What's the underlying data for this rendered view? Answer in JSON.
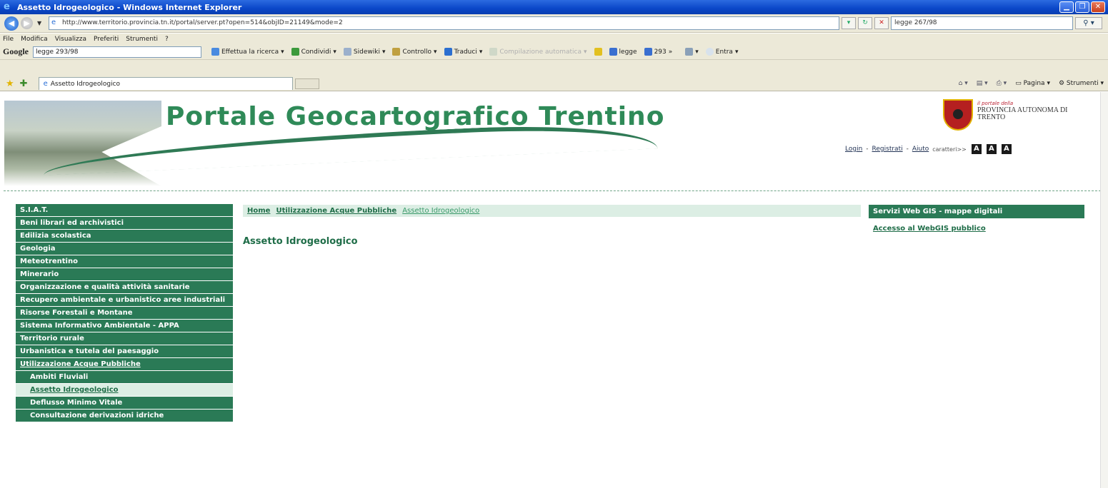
{
  "window": {
    "title": "Assetto Idrogeologico - Windows Internet Explorer"
  },
  "address": {
    "url": "http://www.territorio.provincia.tn.it/portal/server.pt?open=514&objID=21149&mode=2",
    "search": "legge 267/98"
  },
  "menu": [
    "File",
    "Modifica",
    "Visualizza",
    "Preferiti",
    "Strumenti",
    "?"
  ],
  "google_toolbar": {
    "logo": "Google",
    "query": "legge 293/98",
    "search_label": "Effettua la ricerca",
    "items": [
      "Condividi",
      "Sidewiki",
      "Controllo",
      "Traduci",
      "Compilazione automatica",
      "legge",
      "293",
      "Entra"
    ]
  },
  "tab": {
    "label": "Assetto Idrogeologico"
  },
  "commands": [
    "Pagina",
    "Strumenti"
  ],
  "banner": {
    "title": "Portale Geocartografico Trentino",
    "prov_small": "il portale della",
    "prov_name": "PROVINCIA AUTONOMA DI TRENTO",
    "links": {
      "login": "Login",
      "register": "Registrati",
      "help": "Aiuto",
      "chars": "caratteri>>",
      "sep": "-"
    },
    "aa": [
      "A",
      "A",
      "A"
    ]
  },
  "nav": {
    "items": [
      "S.I.A.T.",
      "Beni librari ed archivistici",
      "Edilizia scolastica",
      "Geologia",
      "Meteotrentino",
      "Minerario",
      "Organizzazione e qualità attività sanitarie",
      "Recupero ambientale e urbanistico aree industriali",
      "Risorse Forestali e Montane",
      "Sistema Informativo Ambientale - APPA",
      "Territorio rurale",
      "Urbanistica e tutela del paesaggio",
      "Utilizzazione Acque Pubbliche"
    ],
    "subitems": [
      "Ambiti Fluviali",
      "Assetto Idrogeologico",
      "Deflusso Minimo Vitale",
      "Consultazione derivazioni idriche"
    ]
  },
  "breadcrumb": [
    "Home",
    "Utilizzazione Acque Pubbliche",
    "Assetto Idrogeologico"
  ],
  "main": {
    "heading": "Assetto Idrogeologico"
  },
  "right": {
    "box_title": "Servizi Web GIS - mappe digitali",
    "link": "Accesso al WebGIS pubblico"
  }
}
